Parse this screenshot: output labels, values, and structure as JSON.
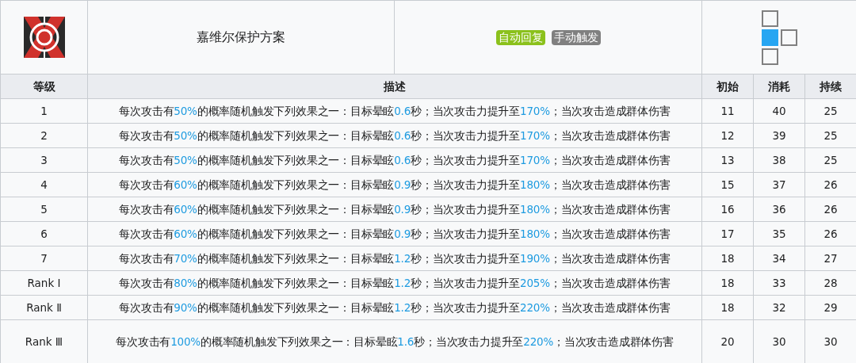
{
  "skill": {
    "name": "嘉维尔保护方案",
    "tags": [
      {
        "label": "自动回复",
        "color": "#8bc11c"
      },
      {
        "label": "手动触发",
        "color": "#808080"
      }
    ],
    "range": [
      [
        {
          "selected": false
        }
      ],
      [
        {
          "selected": true
        },
        {
          "selected": false
        }
      ],
      [
        {
          "selected": false
        }
      ]
    ]
  },
  "table": {
    "columns": [
      "等级",
      "描述",
      "初始",
      "消耗",
      "持续"
    ],
    "rows": [
      {
        "level": "1",
        "description": [
          {
            "text": "每次攻击有",
            "highlight": false
          },
          {
            "text": "50%",
            "highlight": true
          },
          {
            "text": "的概率随机触发下列效果之一：目标晕眩",
            "highlight": false
          },
          {
            "text": "0.6",
            "highlight": true
          },
          {
            "text": "秒；当次攻击力提升至",
            "highlight": false
          },
          {
            "text": "170%",
            "highlight": true
          },
          {
            "text": "；当次攻击造成群体伤害",
            "highlight": false
          }
        ],
        "initial": "11",
        "cost": "40",
        "duration": "25"
      },
      {
        "level": "2",
        "description": [
          {
            "text": "每次攻击有",
            "highlight": false
          },
          {
            "text": "50%",
            "highlight": true
          },
          {
            "text": "的概率随机触发下列效果之一：目标晕眩",
            "highlight": false
          },
          {
            "text": "0.6",
            "highlight": true
          },
          {
            "text": "秒；当次攻击力提升至",
            "highlight": false
          },
          {
            "text": "170%",
            "highlight": true
          },
          {
            "text": "；当次攻击造成群体伤害",
            "highlight": false
          }
        ],
        "initial": "12",
        "cost": "39",
        "duration": "25"
      },
      {
        "level": "3",
        "description": [
          {
            "text": "每次攻击有",
            "highlight": false
          },
          {
            "text": "50%",
            "highlight": true
          },
          {
            "text": "的概率随机触发下列效果之一：目标晕眩",
            "highlight": false
          },
          {
            "text": "0.6",
            "highlight": true
          },
          {
            "text": "秒；当次攻击力提升至",
            "highlight": false
          },
          {
            "text": "170%",
            "highlight": true
          },
          {
            "text": "；当次攻击造成群体伤害",
            "highlight": false
          }
        ],
        "initial": "13",
        "cost": "38",
        "duration": "25"
      },
      {
        "level": "4",
        "description": [
          {
            "text": "每次攻击有",
            "highlight": false
          },
          {
            "text": "60%",
            "highlight": true
          },
          {
            "text": "的概率随机触发下列效果之一：目标晕眩",
            "highlight": false
          },
          {
            "text": "0.9",
            "highlight": true
          },
          {
            "text": "秒；当次攻击力提升至",
            "highlight": false
          },
          {
            "text": "180%",
            "highlight": true
          },
          {
            "text": "；当次攻击造成群体伤害",
            "highlight": false
          }
        ],
        "initial": "15",
        "cost": "37",
        "duration": "26"
      },
      {
        "level": "5",
        "description": [
          {
            "text": "每次攻击有",
            "highlight": false
          },
          {
            "text": "60%",
            "highlight": true
          },
          {
            "text": "的概率随机触发下列效果之一：目标晕眩",
            "highlight": false
          },
          {
            "text": "0.9",
            "highlight": true
          },
          {
            "text": "秒；当次攻击力提升至",
            "highlight": false
          },
          {
            "text": "180%",
            "highlight": true
          },
          {
            "text": "；当次攻击造成群体伤害",
            "highlight": false
          }
        ],
        "initial": "16",
        "cost": "36",
        "duration": "26"
      },
      {
        "level": "6",
        "description": [
          {
            "text": "每次攻击有",
            "highlight": false
          },
          {
            "text": "60%",
            "highlight": true
          },
          {
            "text": "的概率随机触发下列效果之一：目标晕眩",
            "highlight": false
          },
          {
            "text": "0.9",
            "highlight": true
          },
          {
            "text": "秒；当次攻击力提升至",
            "highlight": false
          },
          {
            "text": "180%",
            "highlight": true
          },
          {
            "text": "；当次攻击造成群体伤害",
            "highlight": false
          }
        ],
        "initial": "17",
        "cost": "35",
        "duration": "26"
      },
      {
        "level": "7",
        "description": [
          {
            "text": "每次攻击有",
            "highlight": false
          },
          {
            "text": "70%",
            "highlight": true
          },
          {
            "text": "的概率随机触发下列效果之一：目标晕眩",
            "highlight": false
          },
          {
            "text": "1.2",
            "highlight": true
          },
          {
            "text": "秒；当次攻击力提升至",
            "highlight": false
          },
          {
            "text": "190%",
            "highlight": true
          },
          {
            "text": "；当次攻击造成群体伤害",
            "highlight": false
          }
        ],
        "initial": "18",
        "cost": "34",
        "duration": "27"
      },
      {
        "level": "Rank Ⅰ",
        "description": [
          {
            "text": "每次攻击有",
            "highlight": false
          },
          {
            "text": "80%",
            "highlight": true
          },
          {
            "text": "的概率随机触发下列效果之一：目标晕眩",
            "highlight": false
          },
          {
            "text": "1.2",
            "highlight": true
          },
          {
            "text": "秒；当次攻击力提升至",
            "highlight": false
          },
          {
            "text": "205%",
            "highlight": true
          },
          {
            "text": "；当次攻击造成群体伤害",
            "highlight": false
          }
        ],
        "initial": "18",
        "cost": "33",
        "duration": "28"
      },
      {
        "level": "Rank Ⅱ",
        "description": [
          {
            "text": "每次攻击有",
            "highlight": false
          },
          {
            "text": "90%",
            "highlight": true
          },
          {
            "text": "的概率随机触发下列效果之一：目标晕眩",
            "highlight": false
          },
          {
            "text": "1.2",
            "highlight": true
          },
          {
            "text": "秒；当次攻击力提升至",
            "highlight": false
          },
          {
            "text": "220%",
            "highlight": true
          },
          {
            "text": "；当次攻击造成群体伤害",
            "highlight": false
          }
        ],
        "initial": "18",
        "cost": "32",
        "duration": "29"
      },
      {
        "level": "Rank Ⅲ",
        "description": [
          {
            "text": "每次攻击有",
            "highlight": false
          },
          {
            "text": "100%",
            "highlight": true
          },
          {
            "text": "的概率随机触发下列效果之一：目标晕眩",
            "highlight": false
          },
          {
            "text": "1.6",
            "highlight": true
          },
          {
            "text": "秒；当次攻击力提升至",
            "highlight": false
          },
          {
            "text": "220%",
            "highlight": true
          },
          {
            "text": "；当次攻击造成群体伤害",
            "highlight": false
          }
        ],
        "initial": "20",
        "cost": "30",
        "duration": "30"
      }
    ]
  }
}
